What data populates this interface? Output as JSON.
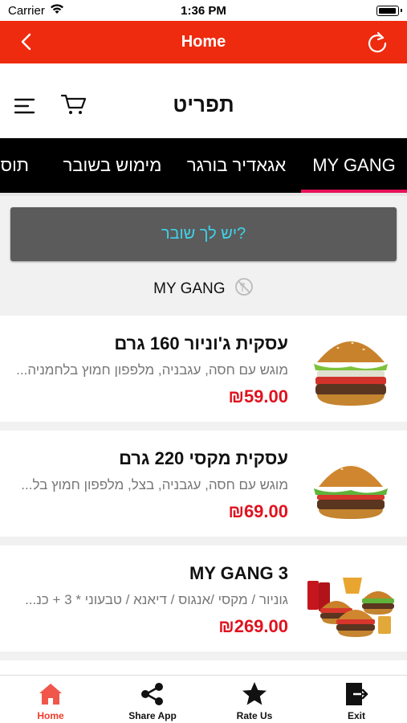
{
  "status_bar": {
    "carrier": "Carrier",
    "time": "1:36 PM"
  },
  "nav": {
    "title": "Home",
    "back_icon": "chevron-left-icon",
    "refresh_icon": "refresh-icon"
  },
  "header": {
    "menu_title": "תפריט",
    "hamburger_icon": "hamburger-icon",
    "cart_icon": "cart-icon"
  },
  "categories": [
    {
      "label": "MY GANG",
      "active": true
    },
    {
      "label": "אגאדיר בורגר",
      "active": false
    },
    {
      "label": "מימוש בשובר",
      "active": false
    },
    {
      "label": "תוס",
      "active": false
    }
  ],
  "coupon_button": "יש לך שובר?",
  "section_title": "MY GANG",
  "items": [
    {
      "name": "עסקית ג'וניור 160 גרם",
      "description": "מוגש עם חסה, עגבניה, מלפפון חמוץ בלחמניה...",
      "price": "₪59.00"
    },
    {
      "name": "עסקית מקסי 220 גרם",
      "description": "מוגש עם חסה, עגבניה, בצל, מלפפון חמוץ בל...",
      "price": "₪69.00"
    },
    {
      "name": "MY GANG 3",
      "description": "גוניור / מקסי /אנגוס / דיאנא / טבעוני * 3 + כנ...",
      "price": "₪269.00"
    }
  ],
  "bottom_tabs": [
    {
      "label": "Home",
      "icon": "home-icon",
      "active": true
    },
    {
      "label": "Share App",
      "icon": "share-icon",
      "active": false
    },
    {
      "label": "Rate Us",
      "icon": "star-icon",
      "active": false
    },
    {
      "label": "Exit",
      "icon": "exit-icon",
      "active": false
    }
  ],
  "colors": {
    "brand_red": "#ee2b0f",
    "tab_accent": "#e8105a",
    "price_red": "#e0121f",
    "coupon_text": "#3fd2ea"
  }
}
